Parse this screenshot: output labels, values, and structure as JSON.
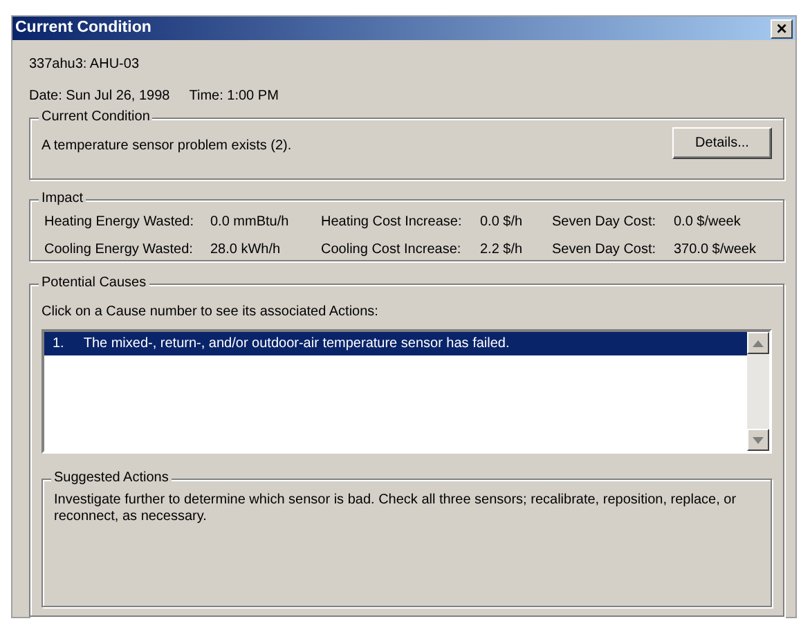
{
  "window": {
    "title": "Current Condition",
    "close": "×"
  },
  "unit": "337ahu3: AHU-03",
  "date": "Date: Sun Jul 26, 1998",
  "time": "Time: 1:00 PM",
  "current_condition": {
    "title": "Current Condition",
    "message": "A temperature sensor problem exists (2).",
    "button": "Details..."
  },
  "impact": {
    "title": "Impact",
    "rows": [
      [
        {
          "label": "Heating Energy Wasted:",
          "value": "0.0 mmBtu/h"
        },
        {
          "label": "Heating Cost Increase:",
          "value": "0.0 $/h"
        },
        {
          "label": "Seven Day Cost:",
          "value": "0.0 $/week"
        }
      ],
      [
        {
          "label": "Cooling Energy Wasted:",
          "value": "28.0 kWh/h"
        },
        {
          "label": "Cooling Cost Increase:",
          "value": "2.2 $/h"
        },
        {
          "label": "Seven Day Cost:",
          "value": "370.0 $/week"
        }
      ]
    ]
  },
  "potential_causes": {
    "title": "Potential Causes",
    "instruction": "Click on a Cause number to see its associated Actions:",
    "causes": [
      {
        "number": "1.",
        "text": "The mixed-, return-, and/or outdoor-air temperature sensor has failed.",
        "selected": true
      }
    ]
  },
  "suggested_actions": {
    "title": "Suggested Actions",
    "text": "Investigate further to determine which sensor is bad.  Check all three sensors; recalibrate, reposition, replace, or reconnect, as necessary."
  }
}
